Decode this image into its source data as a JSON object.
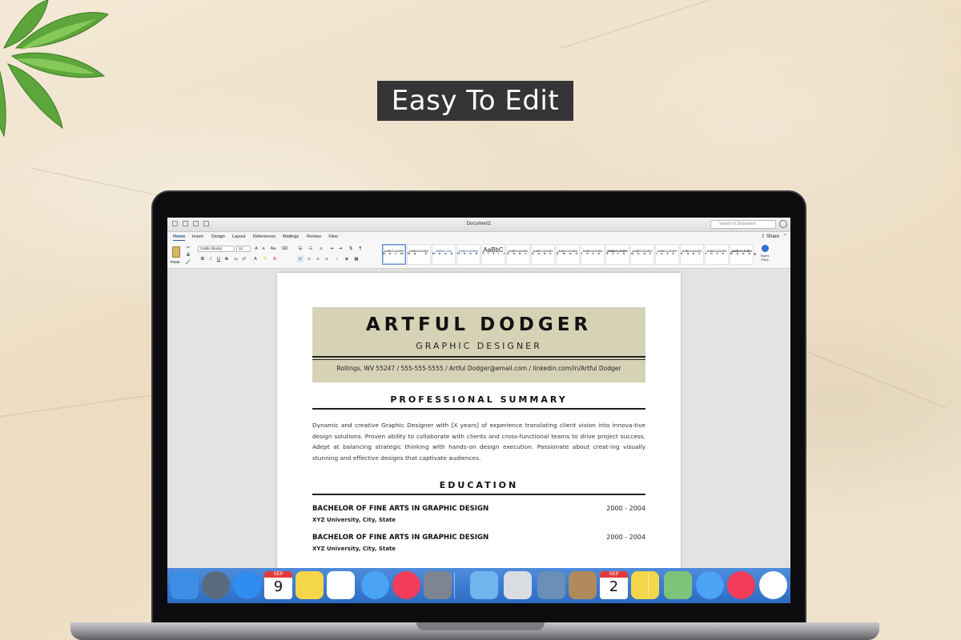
{
  "headline": "Easy To Edit",
  "word": {
    "window_title": "Document1",
    "search_placeholder": "Search in Document",
    "tabs": [
      "Home",
      "Insert",
      "Design",
      "Layout",
      "References",
      "Mailings",
      "Review",
      "View"
    ],
    "active_tab": "Home",
    "share_label": "Share",
    "paste_label": "Paste",
    "font_name": "Calibri (Body)",
    "font_size": "12",
    "styles": [
      {
        "sample": "AaBbCcDdEe",
        "name": "Normal"
      },
      {
        "sample": "AaBbCcDdEe",
        "name": "No Spacing"
      },
      {
        "sample": "AaBbCcDd",
        "name": "Heading 1"
      },
      {
        "sample": "AaBbCcDdEe",
        "name": "Heading 2"
      },
      {
        "sample": "AaBbC",
        "name": "Title"
      },
      {
        "sample": "AaBbCcDdEe",
        "name": "Subtitle"
      },
      {
        "sample": "AaBbCcDdEe",
        "name": "Subtle Emph..."
      },
      {
        "sample": "AaBbCcDdEe",
        "name": "Emphasis"
      },
      {
        "sample": "AaBbCcDdEe",
        "name": "Intense Emp..."
      },
      {
        "sample": "AaBbCcDdEe",
        "name": "Strong"
      },
      {
        "sample": "AaBbCcDdEe",
        "name": "Quote"
      },
      {
        "sample": "AaBbCcDdEe",
        "name": "Intense Quote"
      },
      {
        "sample": "AaBbCcDdEe",
        "name": "Subtle Refer..."
      },
      {
        "sample": "AaBbCcDdEe",
        "name": "Intense Refer..."
      },
      {
        "sample": "AaBbCcDdEe",
        "name": "Book Title"
      }
    ],
    "styles_pane_label": "Styles Pane"
  },
  "resume": {
    "name": "ARTFUL DODGER",
    "role": "GRAPHIC DESIGNER",
    "contact": "Rollings, WV 55247 / 555-555-5555 / Artful Dodger@email.com / linkedin.com/in/Artful Dodger",
    "summary_title": "PROFESSIONAL SUMMARY",
    "summary": "Dynamic and creative Graphic Designer with [X years] of experience translating client vision into innova-tive design solutions. Proven ability to collaborate with clients and cross-functional teams to drive project success. Adept at balancing strategic thinking with hands-on design execution. Passionate about creat-ing visually stunning and effective designs that captivate audiences.",
    "education_title": "EDUCATION",
    "education": [
      {
        "degree": "BACHELOR OF FINE ARTS IN GRAPHIC DESIGN",
        "years": "2000 - 2004",
        "school": "XYZ University, City, State"
      },
      {
        "degree": "BACHELOR OF FINE ARTS IN GRAPHIC DESIGN",
        "years": "2000 - 2004",
        "school": "XYZ University, City, State"
      }
    ]
  },
  "dock": {
    "calendar_left_month": "SEP",
    "calendar_left_day": "9",
    "calendar_right_month": "SEP",
    "calendar_right_day": "2",
    "apps": [
      {
        "icon": "finder-icon",
        "color": "#3d8fe6"
      },
      {
        "icon": "launchpad-icon",
        "color": "#5a6b7d"
      },
      {
        "icon": "safari-icon",
        "color": "#2f8cf0"
      },
      {
        "icon": "calendar-icon",
        "color": "#ffffff"
      },
      {
        "icon": "notes-icon",
        "color": "#f5d54a"
      },
      {
        "icon": "reminders-icon",
        "color": "#ffffff"
      },
      {
        "icon": "messages-icon",
        "color": "#4aa3f5"
      },
      {
        "icon": "itunes-icon",
        "color": "#f23c58"
      },
      {
        "icon": "system-preferences-icon",
        "color": "#7f8590"
      },
      {
        "icon": "downloads-folder-icon",
        "color": "#6fb5ee"
      },
      {
        "icon": "trash-icon",
        "color": "#d9dde2"
      },
      {
        "icon": "preview-icon",
        "color": "#6a8fb8"
      },
      {
        "icon": "contacts-icon",
        "color": "#b08a5a"
      },
      {
        "icon": "calendar-icon",
        "color": "#ffffff"
      },
      {
        "icon": "notes-icon",
        "color": "#f5d54a"
      },
      {
        "icon": "maps-icon",
        "color": "#7dc47a"
      },
      {
        "icon": "messages-icon",
        "color": "#4aa3f5"
      },
      {
        "icon": "itunes-icon",
        "color": "#f23c58"
      },
      {
        "icon": "photos-icon",
        "color": "#ffffff"
      }
    ]
  }
}
